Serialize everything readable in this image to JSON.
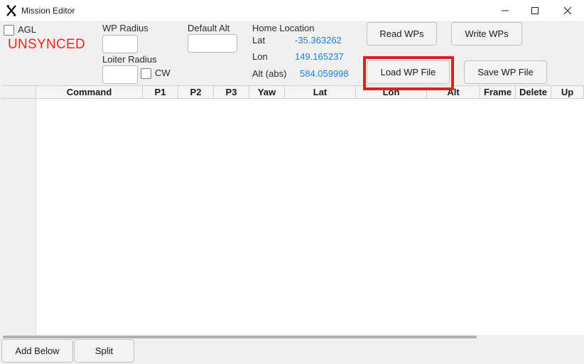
{
  "window": {
    "title": "Mission Editor"
  },
  "header": {
    "agl_label": "AGL",
    "status": "UNSYNCED",
    "status_color": "#ff1e1e",
    "wp_radius_label": "WP Radius",
    "loiter_radius_label": "Loiter Radius",
    "cw_label": "CW",
    "default_alt_label": "Default Alt",
    "home_location_label": "Home Location",
    "lat_label": "Lat",
    "lat_value": "-35.363262",
    "lon_label": "Lon",
    "lon_value": "149.165237",
    "alt_label": "Alt (abs)",
    "alt_value": "584.059998",
    "value_color": "#1e7fd6"
  },
  "buttons": {
    "read_wps": "Read WPs",
    "write_wps": "Write WPs",
    "load_wp_file": "Load WP File",
    "save_wp_file": "Save WP File"
  },
  "table": {
    "columns": [
      "Command",
      "P1",
      "P2",
      "P3",
      "Yaw",
      "Lat",
      "Lon",
      "Alt",
      "Frame",
      "Delete",
      "Up"
    ]
  },
  "footer": {
    "add_below": "Add Below",
    "split": "Split"
  }
}
